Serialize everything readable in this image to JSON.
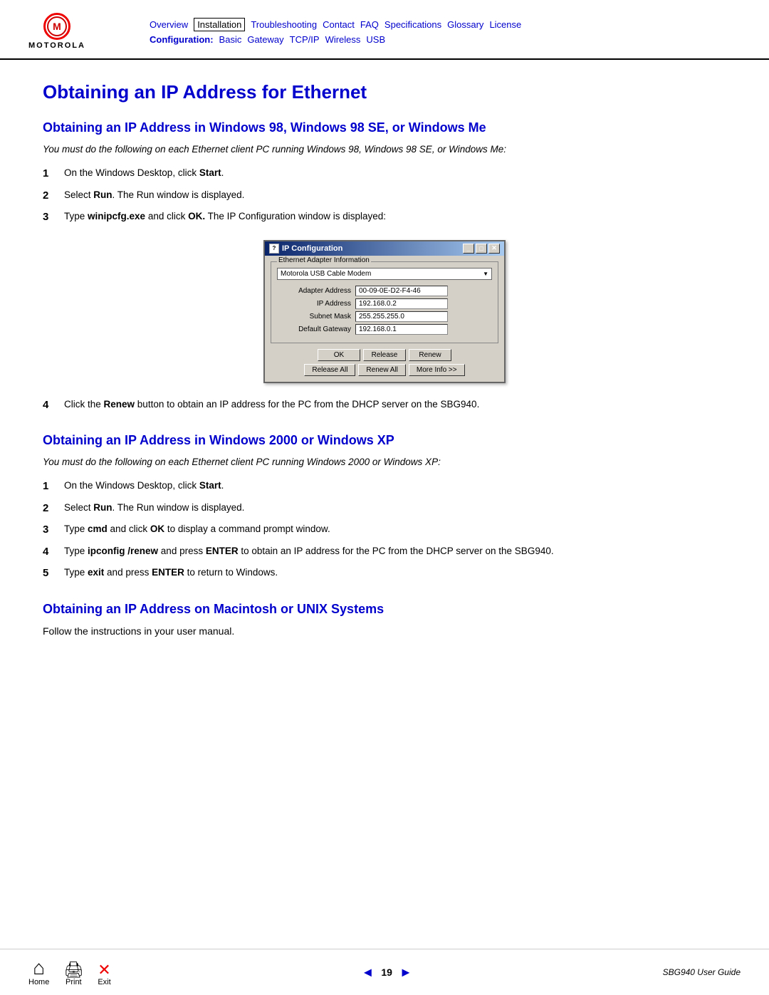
{
  "header": {
    "nav": {
      "row1": {
        "overview": "Overview",
        "installation": "Installation",
        "troubleshooting": "Troubleshooting",
        "contact": "Contact",
        "faq": "FAQ",
        "specifications": "Specifications",
        "glossary": "Glossary",
        "license": "License"
      },
      "row2": {
        "label": "Configuration:",
        "basic": "Basic",
        "gateway": "Gateway",
        "tcpip": "TCP/IP",
        "wireless": "Wireless",
        "usb": "USB"
      }
    }
  },
  "page": {
    "title": "Obtaining an IP Address for Ethernet",
    "section1": {
      "heading": "Obtaining an IP Address in Windows 98, Windows 98 SE, or Windows Me",
      "note": "You must do the following on each Ethernet client PC running Windows 98, Windows 98 SE, or Windows Me:",
      "steps": [
        {
          "num": "1",
          "text_pre": "On the Windows Desktop, click ",
          "bold": "Start",
          "text_post": "."
        },
        {
          "num": "2",
          "text_pre": "Select ",
          "bold": "Run",
          "text_post": ". The Run window is displayed."
        },
        {
          "num": "3",
          "text_pre": "Type ",
          "bold": "winipcfg.exe",
          "text_post": " and click ",
          "bold2": "OK.",
          "text_post2": " The IP Configuration window is displayed:"
        }
      ],
      "step4": {
        "num": "4",
        "text_pre": "Click the ",
        "bold": "Renew",
        "text_post": " button to obtain an IP address for the PC from the DHCP server on the SBG940."
      }
    },
    "section2": {
      "heading": "Obtaining an IP Address in Windows 2000 or Windows XP",
      "note": "You must do the following on each Ethernet client PC running Windows 2000 or Windows XP:",
      "steps": [
        {
          "num": "1",
          "text_pre": "On the Windows Desktop, click ",
          "bold": "Start",
          "text_post": "."
        },
        {
          "num": "2",
          "text_pre": "Select ",
          "bold": "Run",
          "text_post": ". The Run window is displayed."
        },
        {
          "num": "3",
          "text_pre": "Type ",
          "bold": "cmd",
          "text_post": " and click ",
          "bold2": "OK",
          "text_post2": " to display a command prompt window."
        },
        {
          "num": "4",
          "text_pre": "Type ",
          "bold": "ipconfig /renew",
          "text_post": " and press ",
          "bold2": "ENTER",
          "text_post2": " to obtain an IP address for the PC from the DHCP server on the SBG940."
        },
        {
          "num": "5",
          "text_pre": "Type ",
          "bold": "exit",
          "text_post": " and press ",
          "bold2": "ENTER",
          "text_post2": " to return to Windows."
        }
      ]
    },
    "section3": {
      "heading": "Obtaining an IP Address on Macintosh or UNIX Systems",
      "text": "Follow the instructions in your user manual."
    }
  },
  "ip_config_window": {
    "title": "IP Configuration",
    "group_label": "Ethernet Adapter Information",
    "adapter_value": "Motorola USB Cable Modem",
    "fields": [
      {
        "label": "Adapter Address",
        "value": "00-09-0E-D2-F4-46"
      },
      {
        "label": "IP Address",
        "value": "192.168.0.2"
      },
      {
        "label": "Subnet Mask",
        "value": "255.255.255.0"
      },
      {
        "label": "Default Gateway",
        "value": "192.168.0.1"
      }
    ],
    "buttons_row1": [
      "OK",
      "Release",
      "Renew"
    ],
    "buttons_row2": [
      "Release All",
      "Renew All",
      "More Info >>"
    ]
  },
  "footer": {
    "home_label": "Home",
    "print_label": "Print",
    "exit_label": "Exit",
    "page_number": "19",
    "guide_name": "SBG940 User Guide",
    "prev_arrow": "◄",
    "next_arrow": "►"
  }
}
